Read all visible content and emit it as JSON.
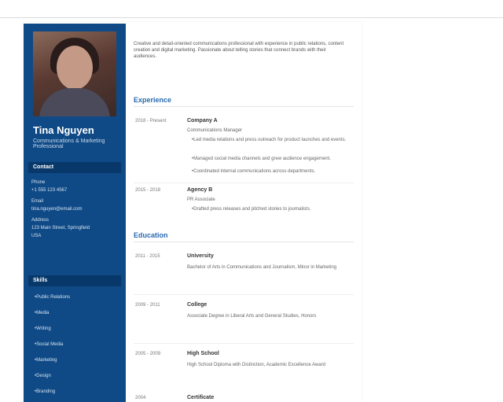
{
  "profile": {
    "name": "Tina Nguyen",
    "role": "Communications & Marketing Professional"
  },
  "sidebar": {
    "contact_heading": "Contact",
    "contact_lines": [
      "Phone",
      "+1 555 123 4567",
      "Email",
      "tina.nguyen@email.com",
      "Address",
      "123 Main Street, Springfield",
      "USA"
    ],
    "skills_heading": "Skills",
    "skills": [
      "Public Relations",
      "Media",
      "Writing",
      "Social Media",
      "Marketing",
      "Design",
      "Branding"
    ]
  },
  "intro": "Creative and detail-oriented communications professional with experience in public relations, content creation and digital marketing. Passionate about telling stories that connect brands with their audiences.",
  "experience": {
    "title": "Experience",
    "items": [
      {
        "date": "2018 - Present",
        "org": "Company A",
        "desc": "Communications Manager",
        "bullets": [
          "Led media relations and press outreach for product launches and events.",
          "Managed social media channels and grew audience engagement.",
          "Coordinated internal communications across departments."
        ]
      },
      {
        "date": "2015 - 2018",
        "org": "Agency B",
        "desc": "PR Associate",
        "bullets": [
          "Drafted press releases and pitched stories to journalists."
        ]
      }
    ]
  },
  "education": {
    "title": "Education",
    "items": [
      {
        "date": "2011 - 2015",
        "org": "University",
        "desc": "Bachelor of Arts in Communications and Journalism, Minor in Marketing"
      },
      {
        "date": "2009 - 2011",
        "org": "College",
        "desc": "Associate Degree in Liberal Arts and General Studies, Honors"
      },
      {
        "date": "2005 - 2009",
        "org": "High School",
        "desc": "High School Diploma with Distinction, Academic Excellence Award"
      },
      {
        "date": "2004",
        "org": "Certificate",
        "desc": ""
      }
    ]
  }
}
